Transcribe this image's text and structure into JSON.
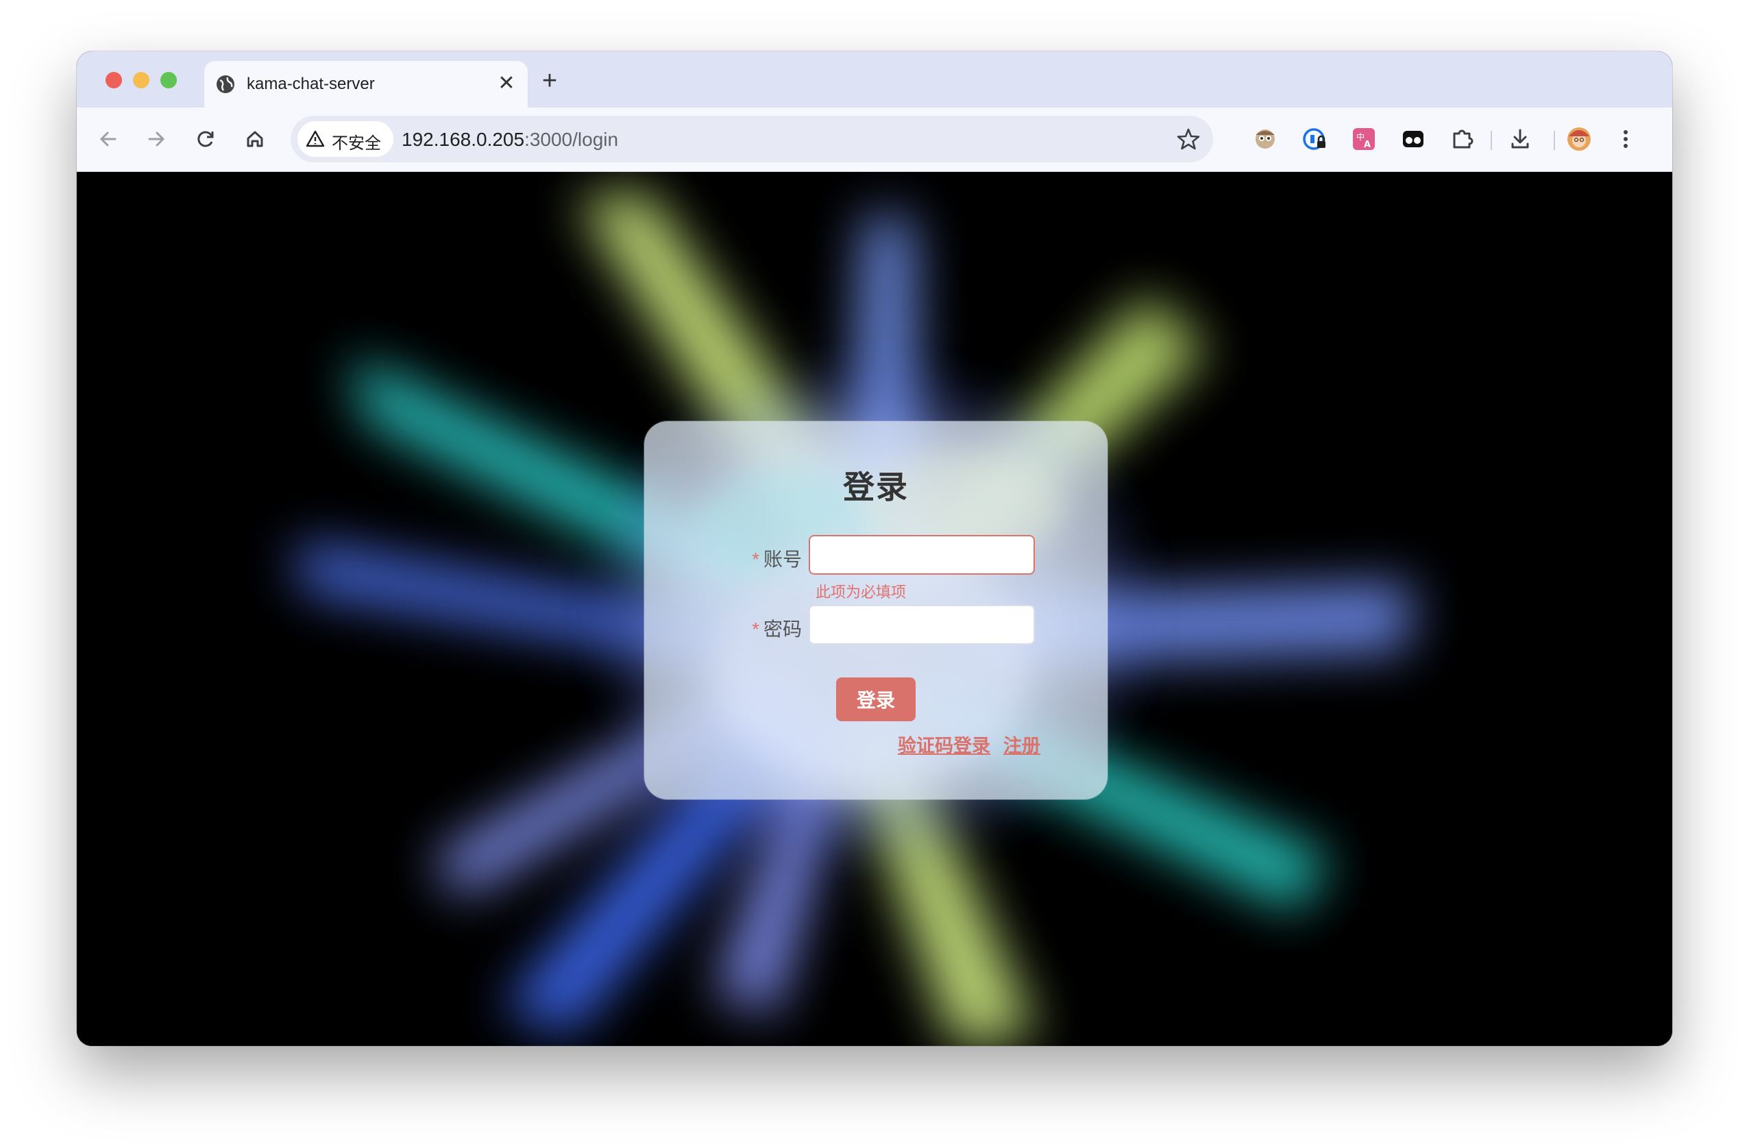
{
  "browser": {
    "tab_title": "kama-chat-server",
    "new_tab_symbol": "+",
    "security_chip_text": "不安全",
    "url_host": "192.168.0.205",
    "url_rest": ":3000/login"
  },
  "login": {
    "title": "登录",
    "account_label": "账号",
    "password_label": "密码",
    "required_mark": "*",
    "account_value": "",
    "password_value": "",
    "account_error": "此项为必填项",
    "submit_label": "登录",
    "sms_login_link": "验证码登录",
    "register_link": "注册"
  },
  "colors": {
    "accent": "#d9726b",
    "error": "#e0726d",
    "tabstrip_bg": "#dde3f5"
  },
  "icons": [
    "back-arrow-icon",
    "forward-arrow-icon",
    "reload-icon",
    "home-icon",
    "warning-icon",
    "bookmark-star-icon",
    "extension-face-icon",
    "extension-lock-icon",
    "translate-icon",
    "extension-mask-icon",
    "puzzle-icon",
    "download-icon",
    "profile-avatar-icon",
    "more-menu-icon"
  ]
}
